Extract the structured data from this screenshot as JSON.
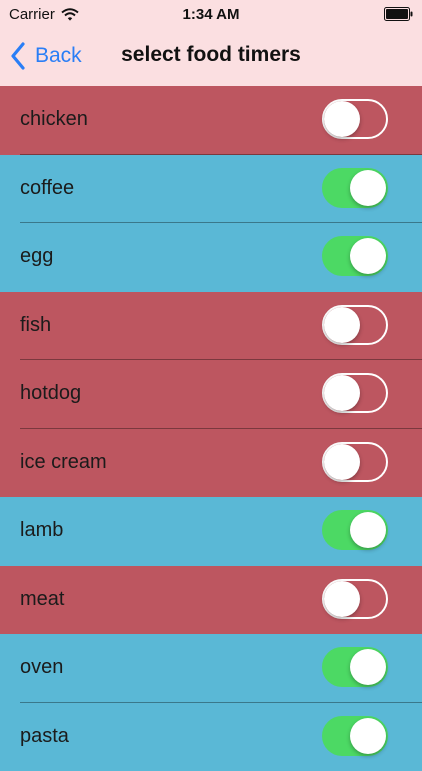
{
  "status_bar": {
    "carrier": "Carrier",
    "time": "1:34 AM",
    "wifi_icon": "wifi-icon",
    "battery_icon": "battery-icon"
  },
  "nav": {
    "back_label": "Back",
    "back_icon": "chevron-left-icon",
    "title": "select food timers"
  },
  "colors": {
    "header_bg": "#fbdfe1",
    "accent_blue": "#2a7ef6",
    "row_red": "#bd5660",
    "row_blue": "#5ab8d6",
    "toggle_on": "#4cd964"
  },
  "items": [
    {
      "label": "chicken",
      "enabled": false
    },
    {
      "label": "coffee",
      "enabled": true
    },
    {
      "label": "egg",
      "enabled": true
    },
    {
      "label": "fish",
      "enabled": false
    },
    {
      "label": "hotdog",
      "enabled": false
    },
    {
      "label": "ice cream",
      "enabled": false
    },
    {
      "label": "lamb",
      "enabled": true
    },
    {
      "label": "meat",
      "enabled": false
    },
    {
      "label": "oven",
      "enabled": true
    },
    {
      "label": "pasta",
      "enabled": true
    }
  ]
}
